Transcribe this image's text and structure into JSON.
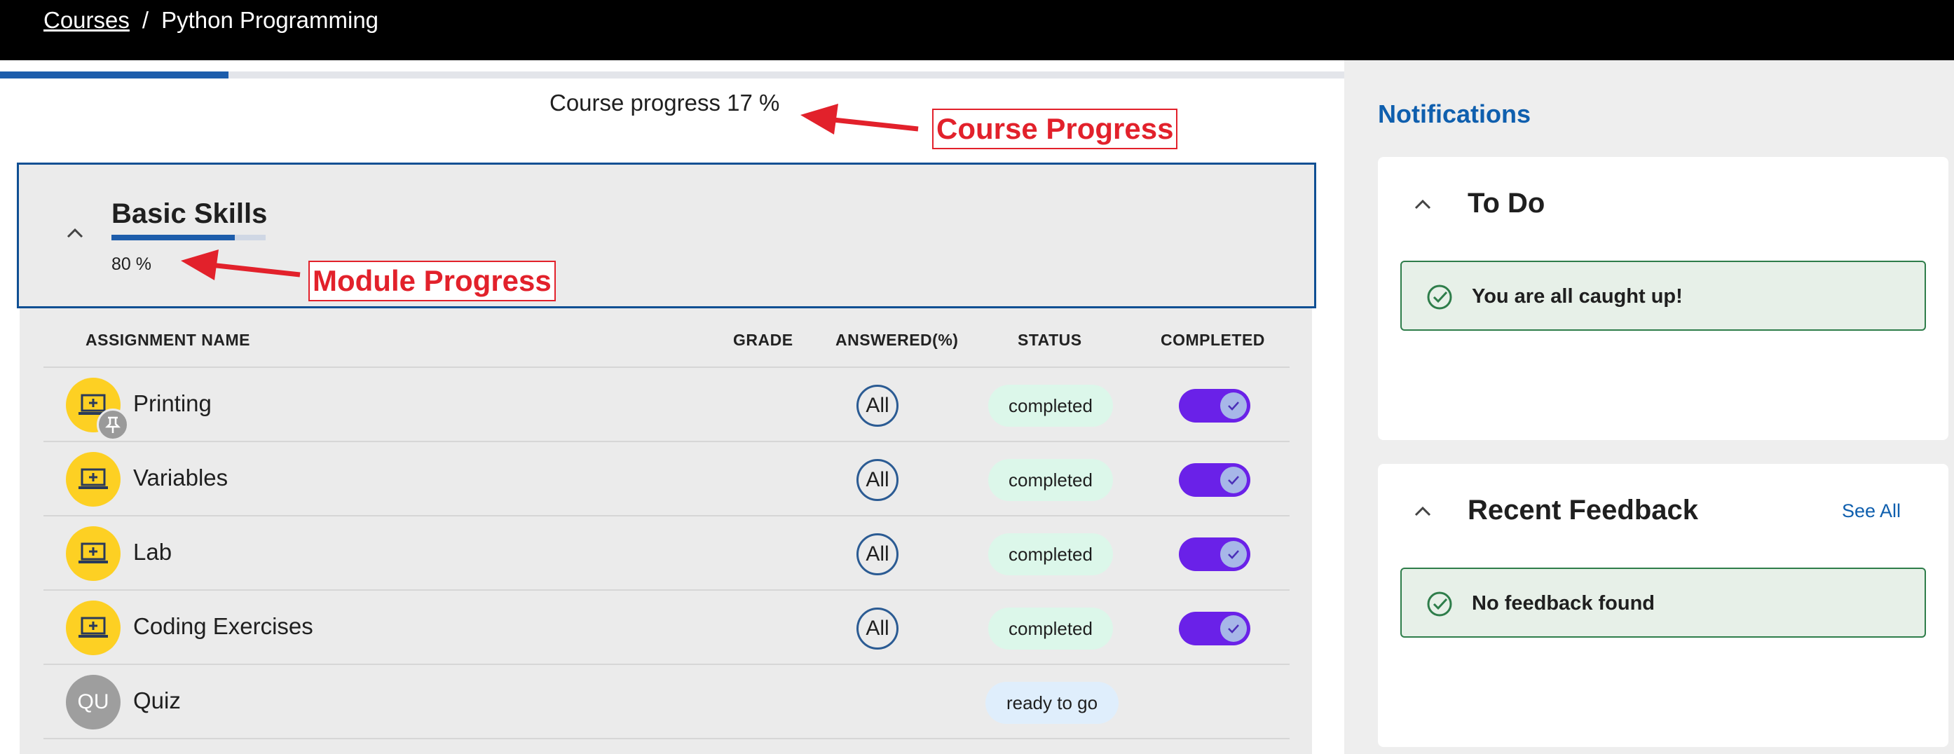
{
  "breadcrumb": {
    "courses": "Courses",
    "separator": "/",
    "current": "Python Programming"
  },
  "course_progress": {
    "fraction": 0.17,
    "text": "Course progress 17 %"
  },
  "module": {
    "title": "Basic Skills",
    "progress_fraction": 0.8,
    "progress_text": "80 %"
  },
  "table": {
    "headers": {
      "name": "ASSIGNMENT NAME",
      "grade": "GRADE",
      "answered": "ANSWERED(%)",
      "status": "STATUS",
      "completed": "COMPLETED"
    },
    "rows": [
      {
        "name": "Printing",
        "answered": "All",
        "status": "completed",
        "completed": true,
        "icon": "laptop-icon",
        "pinned": true
      },
      {
        "name": "Variables",
        "answered": "All",
        "status": "completed",
        "completed": true,
        "icon": "laptop-icon"
      },
      {
        "name": "Lab",
        "answered": "All",
        "status": "completed",
        "completed": true,
        "icon": "laptop-icon"
      },
      {
        "name": "Coding Exercises",
        "answered": "All",
        "status": "completed",
        "completed": true,
        "icon": "laptop-icon"
      },
      {
        "name": "Quiz",
        "avatar_text": "QU",
        "status": "ready to go"
      }
    ]
  },
  "annotations": {
    "course": "Course Progress",
    "module": "Module Progress"
  },
  "notifications": {
    "title": "Notifications",
    "todo": {
      "title": "To Do",
      "message": "You are all caught up!"
    },
    "feedback": {
      "title": "Recent Feedback",
      "see_all": "See All",
      "message": "No feedback found"
    }
  },
  "colors": {
    "accent_blue": "#1d5dab",
    "toggle_purple": "#6a21e8",
    "annotation_red": "#e2212b",
    "avatar_yellow": "#fdd023",
    "success_green": "#2e7d4a"
  }
}
